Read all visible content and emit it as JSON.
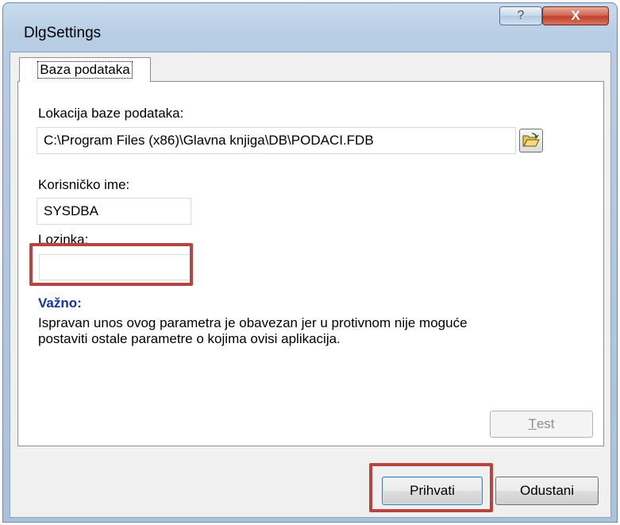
{
  "window": {
    "title": "DlgSettings",
    "help_glyph": "?",
    "close_glyph": "X"
  },
  "tabs": [
    {
      "label": "Baza podataka",
      "selected": true
    }
  ],
  "database": {
    "location_label": "Lokacija baze podataka:",
    "location_value": "C:\\Program Files (x86)\\Glavna knjiga\\DB\\PODACI.FDB",
    "browse_icon": "open-folder-icon"
  },
  "username": {
    "label": "Korisničko ime:",
    "value": "SYSDBA"
  },
  "password": {
    "label_first": "L",
    "label_rest": "ozinka:",
    "value": ""
  },
  "important": {
    "title": "Važno:",
    "line1": "Ispravan unos ovog parametra je obavezan jer u protivnom nije moguće",
    "line2": "postaviti ostale parametre o kojima ovisi aplikacija."
  },
  "buttons": {
    "test_first": "T",
    "test_rest": "est",
    "accept": "Prihvati",
    "cancel": "Odustani"
  },
  "highlight_color": "#b5453e"
}
